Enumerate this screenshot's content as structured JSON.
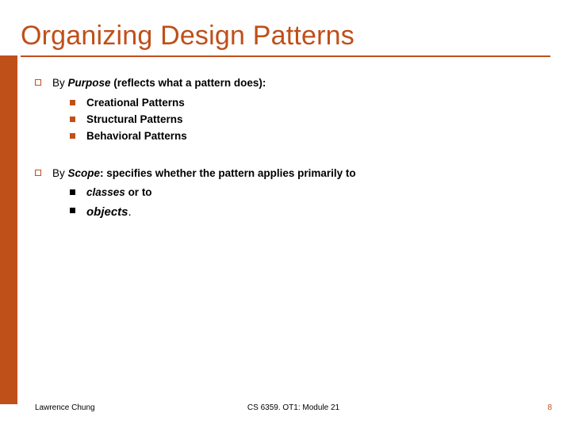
{
  "title": "Organizing Design Patterns",
  "section1": {
    "lead_prefix": "By ",
    "lead_em": "Purpose",
    "lead_suffix": " (reflects what a pattern does):",
    "items": [
      "Creational Patterns",
      "Structural Patterns",
      "Behavioral Patterns"
    ]
  },
  "section2": {
    "lead_prefix": "By ",
    "lead_em": "Scope",
    "lead_suffix": ": specifies whether the pattern applies primarily to",
    "item1_em": "classes",
    "item1_suffix": " or to",
    "item2_em": "objects",
    "item2_suffix": "."
  },
  "footer": {
    "left": "Lawrence Chung",
    "center": "CS 6359. OT1: Module 21",
    "right": "8"
  }
}
